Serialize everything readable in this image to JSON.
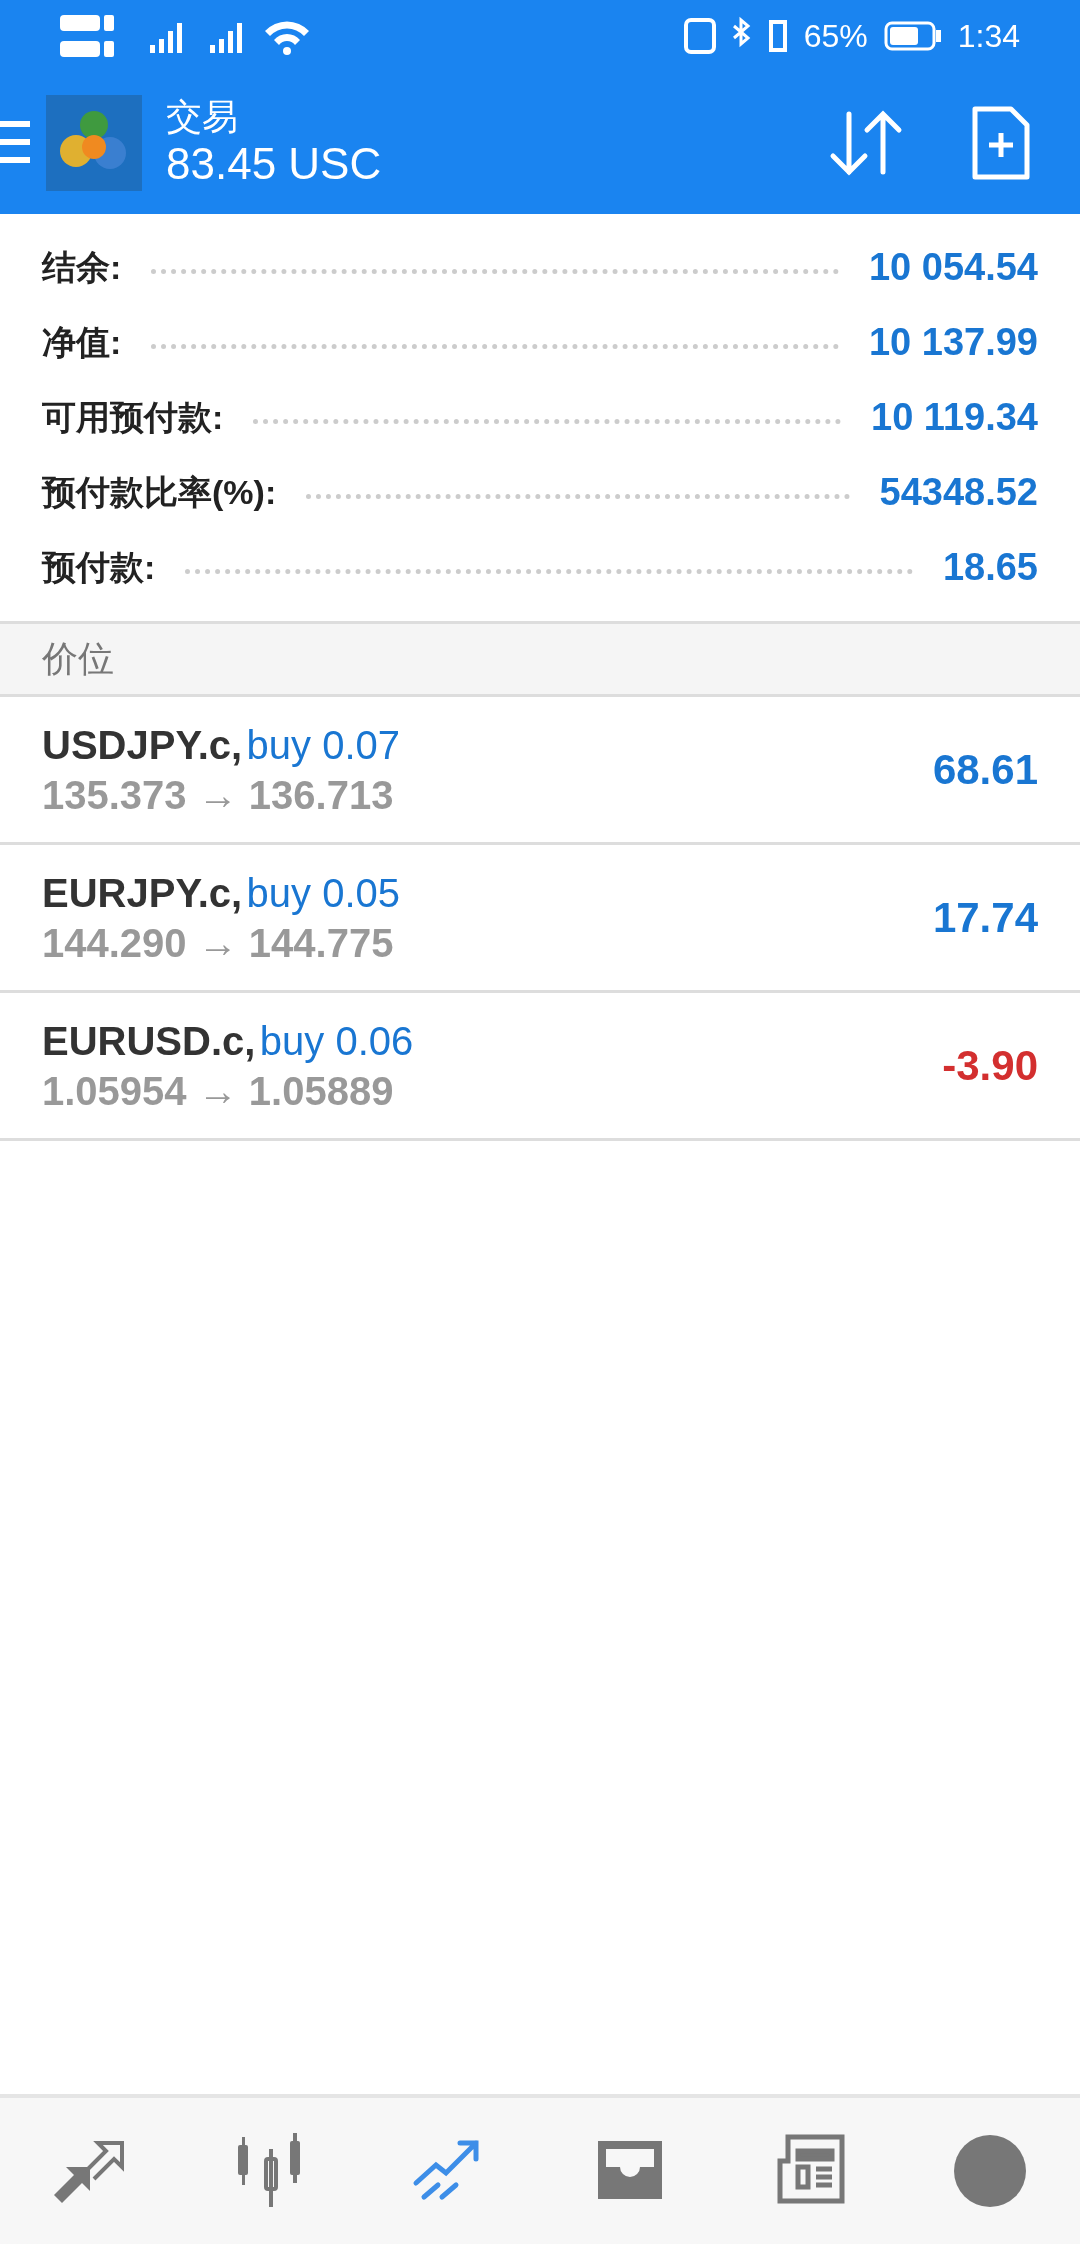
{
  "status_bar": {
    "battery": "65%",
    "time": "1:34"
  },
  "header": {
    "title": "交易",
    "balance": "83.45 USC"
  },
  "summary": [
    {
      "label": "结余:",
      "value": "10 054.54"
    },
    {
      "label": "净值:",
      "value": "10 137.99"
    },
    {
      "label": "可用预付款:",
      "value": "10 119.34"
    },
    {
      "label": "预付款比率(%):",
      "value": "54348.52"
    },
    {
      "label": "预付款:",
      "value": "18.65"
    }
  ],
  "section": {
    "title": "价位"
  },
  "positions": [
    {
      "symbol": "USDJPY.c,",
      "order": "buy 0.07",
      "prices": "135.373 → 136.713",
      "profit": "68.61",
      "color": "#1976d2"
    },
    {
      "symbol": "EURJPY.c,",
      "order": "buy 0.05",
      "prices": "144.290 → 144.775",
      "profit": "17.74",
      "color": "#1976d2"
    },
    {
      "symbol": "EURUSD.c,",
      "order": "buy 0.06",
      "prices": "1.05954 → 1.05889",
      "profit": "-3.90",
      "color": "#d32f2f"
    }
  ],
  "bottom_nav": [
    {
      "kind": "quotes",
      "selected": false
    },
    {
      "kind": "chart",
      "selected": false
    },
    {
      "kind": "trade",
      "selected": true
    },
    {
      "kind": "inbox",
      "selected": false
    },
    {
      "kind": "news",
      "selected": false
    },
    {
      "kind": "chat",
      "selected": false
    }
  ]
}
